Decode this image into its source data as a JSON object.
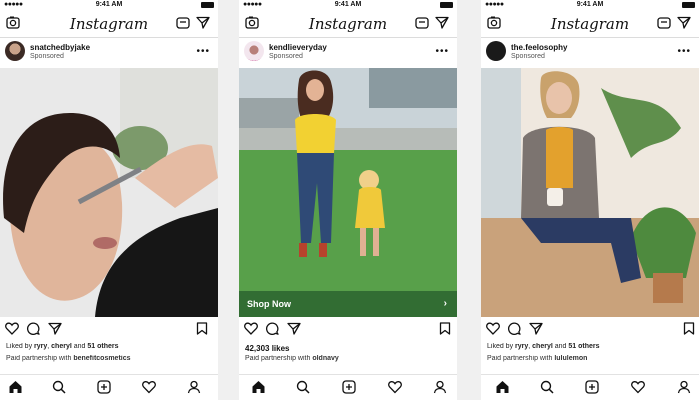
{
  "status": {
    "time": "9:41 AM",
    "signal": "●●●●●"
  },
  "app": {
    "logo": "Instagram"
  },
  "posts": [
    {
      "user": "snatchedbyjake",
      "sponsored": "Sponsored",
      "liked_prefix": "Liked by ",
      "liked_user1": "ryry",
      "liked_sep": ", ",
      "liked_user2": "cheryl",
      "liked_mid": " and ",
      "liked_others": "51 others",
      "paid_prefix": "Paid partnership with ",
      "partner": "benefitcosmetics"
    },
    {
      "user": "kendlieveryday",
      "sponsored": "Sponsored",
      "cta": "Shop Now",
      "likes": "42,303 likes",
      "paid_prefix": "Paid partnership with ",
      "partner": "oldnavy"
    },
    {
      "user": "the.feelosophy",
      "sponsored": "Sponsored",
      "liked_prefix": "Liked by ",
      "liked_user1": "ryry",
      "liked_sep": ", ",
      "liked_user2": "cheryl",
      "liked_mid": " and ",
      "liked_others": "51 others",
      "paid_prefix": "Paid partnership with ",
      "partner": "lululemon"
    }
  ],
  "icons": {
    "top": [
      "camera-icon",
      "igtv-icon",
      "direct-message-icon"
    ],
    "actions": [
      "heart-icon",
      "comment-icon",
      "share-icon",
      "bookmark-icon"
    ],
    "nav": [
      "home-icon",
      "search-icon",
      "add-post-icon",
      "activity-heart-icon",
      "profile-icon"
    ]
  },
  "colors": {
    "text": "#111111",
    "separator": "#dcdcdc",
    "cta_bar": "#285f2d"
  }
}
